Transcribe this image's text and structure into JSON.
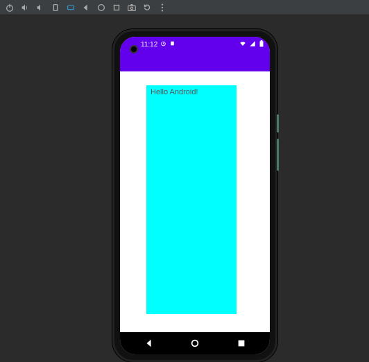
{
  "statusbar": {
    "time": "11:12"
  },
  "app": {
    "greeting": "Hello Android!"
  }
}
